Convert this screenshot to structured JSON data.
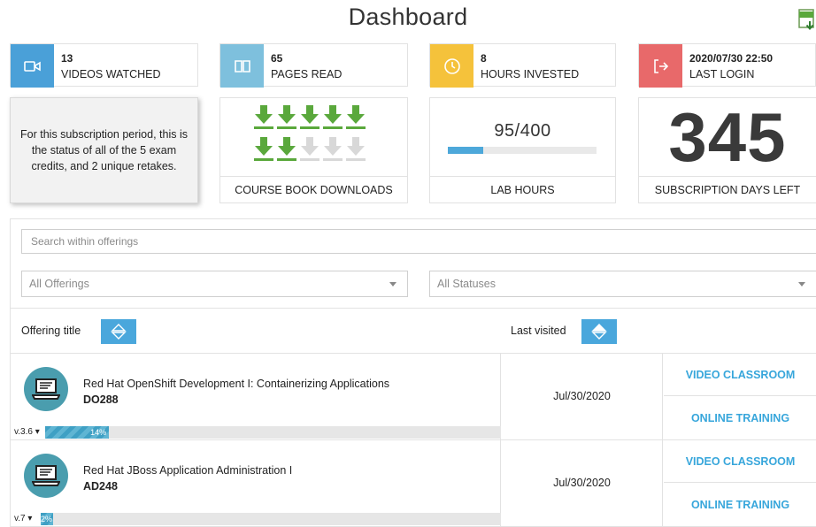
{
  "page": {
    "title": "Dashboard",
    "export_icon": "csv-download-icon"
  },
  "colors": {
    "videos": "#4aa0d8",
    "pages": "#7ec0dd",
    "hours": "#f5c23b",
    "login": "#e8696a",
    "accent": "#37a6db",
    "arrow_done": "#5aa83c",
    "arrow_pending": "#d8d8d8"
  },
  "stats": [
    {
      "value": "13",
      "label": "VIDEOS WATCHED",
      "icon": "video-camera-icon"
    },
    {
      "value": "65",
      "label": "PAGES READ",
      "icon": "open-book-icon"
    },
    {
      "value": "8",
      "label": "HOURS INVESTED",
      "icon": "clock-icon"
    },
    {
      "value": "2020/07/30 22:50",
      "label": "LAST LOGIN",
      "icon": "logout-arrow-icon"
    }
  ],
  "exam_info": "For this subscription period, this is the status of all of the 5 exam credits, and 2 unique retakes.",
  "downloads": {
    "label": "COURSE BOOK DOWNLOADS",
    "total": 10,
    "downloaded": 7
  },
  "lab": {
    "value": "95/400",
    "label": "LAB HOURS",
    "progress": 0.2375
  },
  "subscription": {
    "days": "345",
    "label": "SUBSCRIPTION DAYS LEFT"
  },
  "filters": {
    "search_placeholder": "Search within offerings",
    "offerings": "All Offerings",
    "statuses": "All Statuses"
  },
  "table": {
    "col_title": "Offering title",
    "col_visited": "Last visited",
    "rows": [
      {
        "title": "Red Hat OpenShift Development I: Containerizing Applications",
        "code": "DO288",
        "version": "v.3.6 ▾",
        "progress": "14%",
        "progress_value": 0.14,
        "visited": "Jul/30/2020",
        "link1": "VIDEO CLASSROOM",
        "link2": "ONLINE TRAINING"
      },
      {
        "title": "Red Hat JBoss Application Administration I",
        "code": "AD248",
        "version": "v.7 ▾",
        "progress": "2%",
        "progress_value": 0.02,
        "visited": "Jul/30/2020",
        "link1": "VIDEO CLASSROOM",
        "link2": "ONLINE TRAINING"
      }
    ]
  }
}
